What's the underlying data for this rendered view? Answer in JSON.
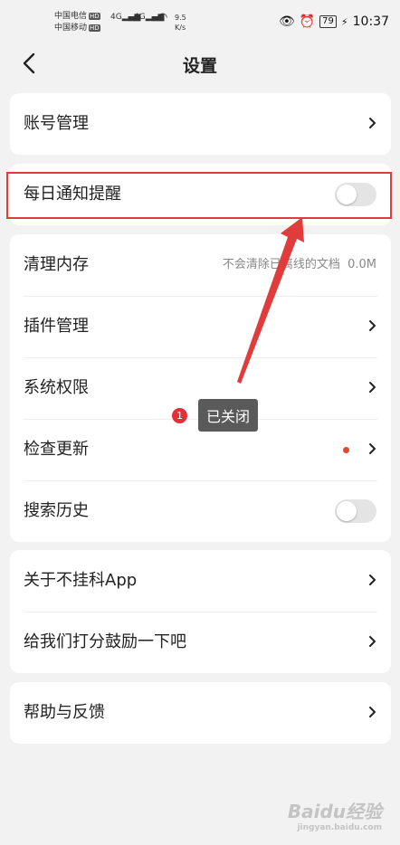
{
  "status": {
    "carrier1": "中国电信",
    "carrier2": "中国移动",
    "hd": "HD",
    "net": "4G",
    "speed": "9.5",
    "speed_unit": "K/s",
    "battery": "79",
    "time": "10:37"
  },
  "nav": {
    "title": "设置"
  },
  "groups": {
    "account": "账号管理",
    "daily_notify": "每日通知提醒",
    "clear_memory": "清理内存",
    "clear_memory_note": "不会清除已离线的文档",
    "clear_memory_size": "0.0M",
    "plugins": "插件管理",
    "permissions": "系统权限",
    "update": "检查更新",
    "search_history": "搜索历史",
    "about": "关于不挂科App",
    "rate": "给我们打分鼓励一下吧",
    "help": "帮助与反馈"
  },
  "annotation": {
    "num": "1",
    "text": "已关闭"
  },
  "watermark": {
    "main": "Baidu经验",
    "sub": "jingyan.baidu.com"
  },
  "colors": {
    "accent_red": "#e03c3c",
    "dot": "#e8462e"
  }
}
